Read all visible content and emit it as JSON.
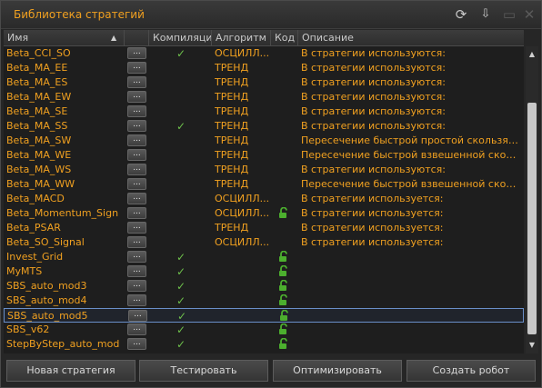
{
  "window": {
    "title": "Библиотека стратегий"
  },
  "columns": [
    "Имя",
    "Компиляция",
    "Алгоритм",
    "Код",
    "Описание"
  ],
  "sort_indicator": "▲",
  "more_label": "...",
  "rows": [
    {
      "name": "Beta_CCI_SO",
      "compiled": true,
      "algorithm": "ОСЦИЛЛ...",
      "code_icon": false,
      "description": "В стратегии используются:",
      "selected": false
    },
    {
      "name": "Beta_MA_EE",
      "compiled": false,
      "algorithm": "ТРЕНД",
      "code_icon": false,
      "description": "В стратегии используются:",
      "selected": false
    },
    {
      "name": "Beta_MA_ES",
      "compiled": false,
      "algorithm": "ТРЕНД",
      "code_icon": false,
      "description": "В стратегии используются:",
      "selected": false
    },
    {
      "name": "Beta_MA_EW",
      "compiled": false,
      "algorithm": "ТРЕНД",
      "code_icon": false,
      "description": "В стратегии используются:",
      "selected": false
    },
    {
      "name": "Beta_MA_SE",
      "compiled": false,
      "algorithm": "ТРЕНД",
      "code_icon": false,
      "description": "В стратегии используются:",
      "selected": false
    },
    {
      "name": "Beta_MA_SS",
      "compiled": true,
      "algorithm": "ТРЕНД",
      "code_icon": false,
      "description": "В стратегии используются:",
      "selected": false
    },
    {
      "name": "Beta_MA_SW",
      "compiled": false,
      "algorithm": "ТРЕНД",
      "code_icon": false,
      "description": "Пересечение быстрой простой скользящей с...",
      "selected": false
    },
    {
      "name": "Beta_MA_WE",
      "compiled": false,
      "algorithm": "ТРЕНД",
      "code_icon": false,
      "description": "Пересечение быстрой взвешенной скользящ...",
      "selected": false
    },
    {
      "name": "Beta_MA_WS",
      "compiled": false,
      "algorithm": "ТРЕНД",
      "code_icon": false,
      "description": "В стратегии используются:",
      "selected": false
    },
    {
      "name": "Beta_MA_WW",
      "compiled": false,
      "algorithm": "ТРЕНД",
      "code_icon": false,
      "description": "Пересечение быстрой взвешенной скользящ...",
      "selected": false
    },
    {
      "name": "Beta_MACD",
      "compiled": false,
      "algorithm": "ОСЦИЛЛ...",
      "code_icon": false,
      "description": "В стратегии используется:",
      "selected": false
    },
    {
      "name": "Beta_Momentum_Sign",
      "compiled": false,
      "algorithm": "ОСЦИЛЛ...",
      "code_icon": true,
      "description": "В стратегии используется:",
      "selected": false
    },
    {
      "name": "Beta_PSAR",
      "compiled": false,
      "algorithm": "ТРЕНД",
      "code_icon": false,
      "description": "В стратегии используется:",
      "selected": false
    },
    {
      "name": "Beta_SO_Signal",
      "compiled": false,
      "algorithm": "ОСЦИЛЛ...",
      "code_icon": false,
      "description": "В стратегии используется:",
      "selected": false
    },
    {
      "name": "Invest_Grid",
      "compiled": true,
      "algorithm": "",
      "code_icon": true,
      "description": "",
      "selected": false
    },
    {
      "name": "MyMTS",
      "compiled": true,
      "algorithm": "",
      "code_icon": true,
      "description": "",
      "selected": false
    },
    {
      "name": "SBS_auto_mod3",
      "compiled": true,
      "algorithm": "",
      "code_icon": true,
      "description": "",
      "selected": false
    },
    {
      "name": "SBS_auto_mod4",
      "compiled": true,
      "algorithm": "",
      "code_icon": true,
      "description": "",
      "selected": false
    },
    {
      "name": "SBS_auto_mod5",
      "compiled": true,
      "algorithm": "",
      "code_icon": true,
      "description": "",
      "selected": true
    },
    {
      "name": "SBS_v62",
      "compiled": true,
      "algorithm": "",
      "code_icon": true,
      "description": "",
      "selected": false
    },
    {
      "name": "StepByStep_auto_mod",
      "compiled": true,
      "algorithm": "",
      "code_icon": true,
      "description": "",
      "selected": false
    }
  ],
  "buttons": [
    "Новая стратегия",
    "Тестировать",
    "Оптимизировать",
    "Создать робот"
  ],
  "icons": {
    "refresh": "refresh-icon",
    "import": "download-icon",
    "minimize": "minimize-icon",
    "close": "close-icon",
    "check": "check-icon",
    "code": "unlock-icon"
  },
  "colors": {
    "name_text": "#f0a020",
    "check": "#6dbf4b",
    "code_icon": "#4caf2e",
    "selection_border": "#6a8fc8"
  }
}
